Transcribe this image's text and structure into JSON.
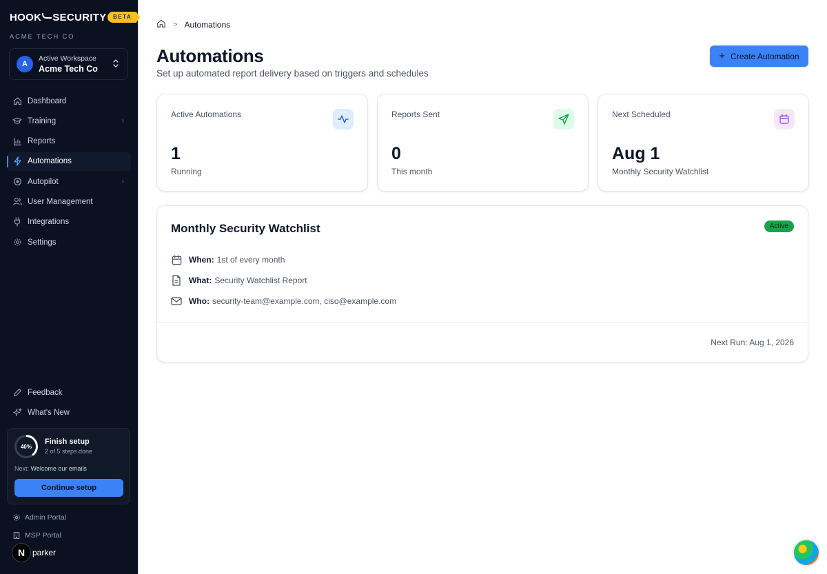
{
  "sidebar": {
    "brand_left": "HOOK",
    "brand_right": "SECURITY",
    "beta": "BETA",
    "org": "ACME TECH CO",
    "workspace": {
      "avatar": "A",
      "caption": "Active Workspace",
      "name": "Acme Tech Co"
    },
    "nav": [
      {
        "label": "Dashboard",
        "icon": "home-icon"
      },
      {
        "label": "Training",
        "icon": "graduation-cap-icon"
      },
      {
        "label": "Reports",
        "icon": "bar-chart-icon"
      },
      {
        "label": "Automations",
        "icon": "zap-icon",
        "active": true
      },
      {
        "label": "Autopilot",
        "icon": "target-icon"
      },
      {
        "label": "User Management",
        "icon": "users-icon"
      },
      {
        "label": "Integrations",
        "icon": "plug-icon"
      },
      {
        "label": "Settings",
        "icon": "gear-icon"
      }
    ],
    "bottom": [
      {
        "label": "Feedback",
        "icon": "pencil-icon"
      },
      {
        "label": "What's New",
        "icon": "sparkles-icon"
      }
    ],
    "setup": {
      "percent": "40%",
      "progress": 0.4,
      "title": "Finish setup",
      "subtitle": "2 of 5 steps done",
      "next_prefix": "Next:",
      "next_step": "Welcome our emails",
      "button": "Continue setup"
    },
    "portals": [
      {
        "label": "Admin Portal",
        "icon": "gear-icon"
      },
      {
        "label": "MSP Portal",
        "icon": "building-icon"
      }
    ],
    "user": {
      "avatar": "N",
      "name": "parker"
    }
  },
  "header": {
    "breadcrumb": "Automations",
    "title": "Automations",
    "subtitle": "Set up automated report delivery based on triggers and schedules",
    "create_button": "Create Automation"
  },
  "stats": [
    {
      "label": "Active Automations",
      "value": "1",
      "sub": "Running",
      "icon": "activity-icon",
      "icon_bg": "#e0ecff",
      "icon_color": "#2563eb"
    },
    {
      "label": "Reports Sent",
      "value": "0",
      "sub": "This month",
      "icon": "send-icon",
      "icon_bg": "#dcfce7",
      "icon_color": "#16a34a"
    },
    {
      "label": "Next Scheduled",
      "value": "Aug 1",
      "sub": "Monthly Security Watchlist",
      "icon": "calendar-icon",
      "icon_bg": "#f3e8ff",
      "icon_color": "#a855f7"
    }
  ],
  "automation": {
    "title": "Monthly Security Watchlist",
    "status": "Active",
    "details": [
      {
        "label": "When:",
        "value": "1st of every month",
        "icon": "calendar-icon"
      },
      {
        "label": "What:",
        "value": "Security Watchlist Report",
        "icon": "document-icon"
      },
      {
        "label": "Who:",
        "value": "security-team@example.com, ciso@example.com",
        "icon": "mail-icon"
      }
    ],
    "next_run": "Next Run: Aug 1, 2026"
  },
  "colors": {
    "sidebar_bg": "#0b1120",
    "accent": "#3b82f6",
    "beta": "#fbbf24",
    "active_badge": "#16a34a"
  }
}
